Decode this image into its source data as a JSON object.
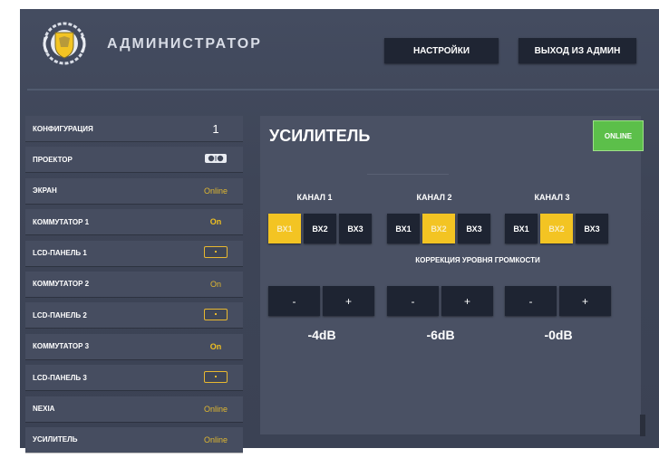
{
  "header": {
    "title": "АДМИНИСТРАТОР",
    "settings_label": "НАСТРОЙКИ",
    "exit_label": "ВЫХОД ИЗ АДМИН"
  },
  "sidebar": {
    "items": [
      {
        "label": "КОНФИГУРАЦИЯ",
        "value": "1"
      },
      {
        "label": "ПРОЕКТОР",
        "value": ""
      },
      {
        "label": "ЭКРАН",
        "value": "Online"
      },
      {
        "label": "КОММУТАТОР 1",
        "value": "On"
      },
      {
        "label": "LCD-ПАНЕЛЬ 1",
        "value": ""
      },
      {
        "label": "КОММУТАТОР 2",
        "value": "On"
      },
      {
        "label": "LCD-ПАНЕЛЬ 2",
        "value": ""
      },
      {
        "label": "КОММУТАТОР 3",
        "value": "On"
      },
      {
        "label": "LCD-ПАНЕЛЬ 3",
        "value": ""
      },
      {
        "label": "NEXIA",
        "value": "Online"
      },
      {
        "label": "УСИЛИТЕЛЬ",
        "value": "Online"
      }
    ]
  },
  "main": {
    "title": "УСИЛИТЕЛЬ",
    "status": "ONLINE",
    "channels": [
      {
        "label": "КАНАЛ 1",
        "inputs": [
          "ВХ1",
          "ВХ2",
          "ВХ3"
        ],
        "active": "ВХ1",
        "level": "-4dB"
      },
      {
        "label": "КАНАЛ 2",
        "inputs": [
          "ВХ1",
          "ВХ2",
          "ВХ3"
        ],
        "active": "ВХ2",
        "level": "-6dB"
      },
      {
        "label": "КАНАЛ 3",
        "inputs": [
          "ВХ1",
          "ВХ2",
          "ВХ3"
        ],
        "active": "ВХ2",
        "level": "-0dB"
      }
    ],
    "volume_label": "КОРРЕКЦИЯ УРОВНЯ ГРОМКОСТИ",
    "minus": "-",
    "plus": "+"
  },
  "icons": {
    "logo": "coat-of-arms-logo",
    "projector": "projector-icon",
    "lcd": "lcd-panel-icon"
  },
  "colors": {
    "accent": "#f3c423",
    "online_green": "#5cbf4a",
    "button_dark": "#1e2432"
  }
}
